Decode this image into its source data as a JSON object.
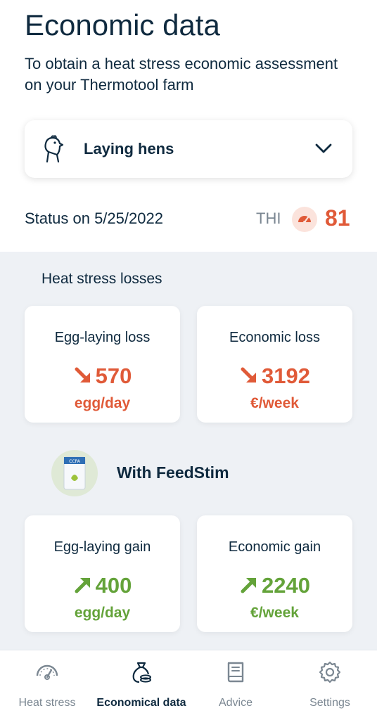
{
  "header": {
    "title": "Economic data",
    "subtitle": "To obtain a heat stress economic assessment on your Thermotool farm"
  },
  "animal_selector": {
    "selected": "Laying hens",
    "icon": "hen-icon"
  },
  "status": {
    "text": "Status on 5/25/2022",
    "thi_label": "THI",
    "thi_value": "81",
    "thi_icon": "gauge-icon"
  },
  "losses": {
    "section_label": "Heat stress losses",
    "cards": [
      {
        "title": "Egg-laying loss",
        "value": "570",
        "unit": "egg/day",
        "trend": "down"
      },
      {
        "title": "Economic loss",
        "value": "3192",
        "unit": "€/week",
        "trend": "down"
      }
    ]
  },
  "product": {
    "title": "With FeedStim",
    "icon": "feedstim-bag-image"
  },
  "gains": {
    "cards": [
      {
        "title": "Egg-laying gain",
        "value": "400",
        "unit": "egg/day",
        "trend": "up"
      },
      {
        "title": "Economic gain",
        "value": "2240",
        "unit": "€/week",
        "trend": "up"
      }
    ]
  },
  "nav": {
    "items": [
      {
        "label": "Heat stress",
        "icon": "gauge-icon",
        "active": false
      },
      {
        "label": "Economical data",
        "icon": "money-bag-icon",
        "active": true
      },
      {
        "label": "Advice",
        "icon": "book-icon",
        "active": false
      },
      {
        "label": "Settings",
        "icon": "gear-icon",
        "active": false
      }
    ]
  },
  "colors": {
    "primary_text": "#0f2a3f",
    "loss": "#e05a38",
    "gain": "#64a33a",
    "muted": "#7b8792",
    "background": "#eef1f5"
  }
}
